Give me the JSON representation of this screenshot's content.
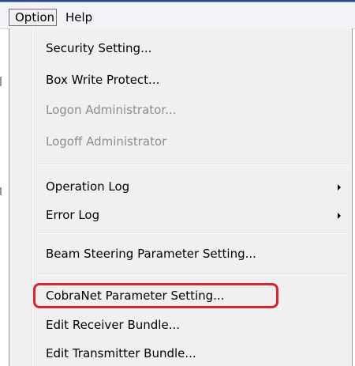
{
  "menubar": {
    "items": [
      {
        "label": "Option"
      },
      {
        "label": "Help"
      }
    ]
  },
  "option_menu": {
    "items": [
      {
        "label": "Security Setting...",
        "enabled": true
      },
      {
        "label": "Box Write Protect...",
        "enabled": true
      },
      {
        "label": "Logon Administrator...",
        "enabled": false
      },
      {
        "label": "Logoff Administrator",
        "enabled": false
      },
      {
        "label": "Operation Log",
        "enabled": true,
        "has_submenu": true
      },
      {
        "label": "Error Log",
        "enabled": true,
        "has_submenu": true
      },
      {
        "label": "Beam Steering Parameter Setting...",
        "enabled": true
      },
      {
        "label": "CobraNet Parameter Setting...",
        "enabled": true,
        "highlighted": true
      },
      {
        "label": "Edit Receiver Bundle...",
        "enabled": true
      },
      {
        "label": "Edit Transmitter Bundle...",
        "enabled": true
      }
    ]
  },
  "colors": {
    "highlight_outline": "#e0202a",
    "disabled_text": "#8d8d8d",
    "menu_background": "#f0f0f0"
  }
}
